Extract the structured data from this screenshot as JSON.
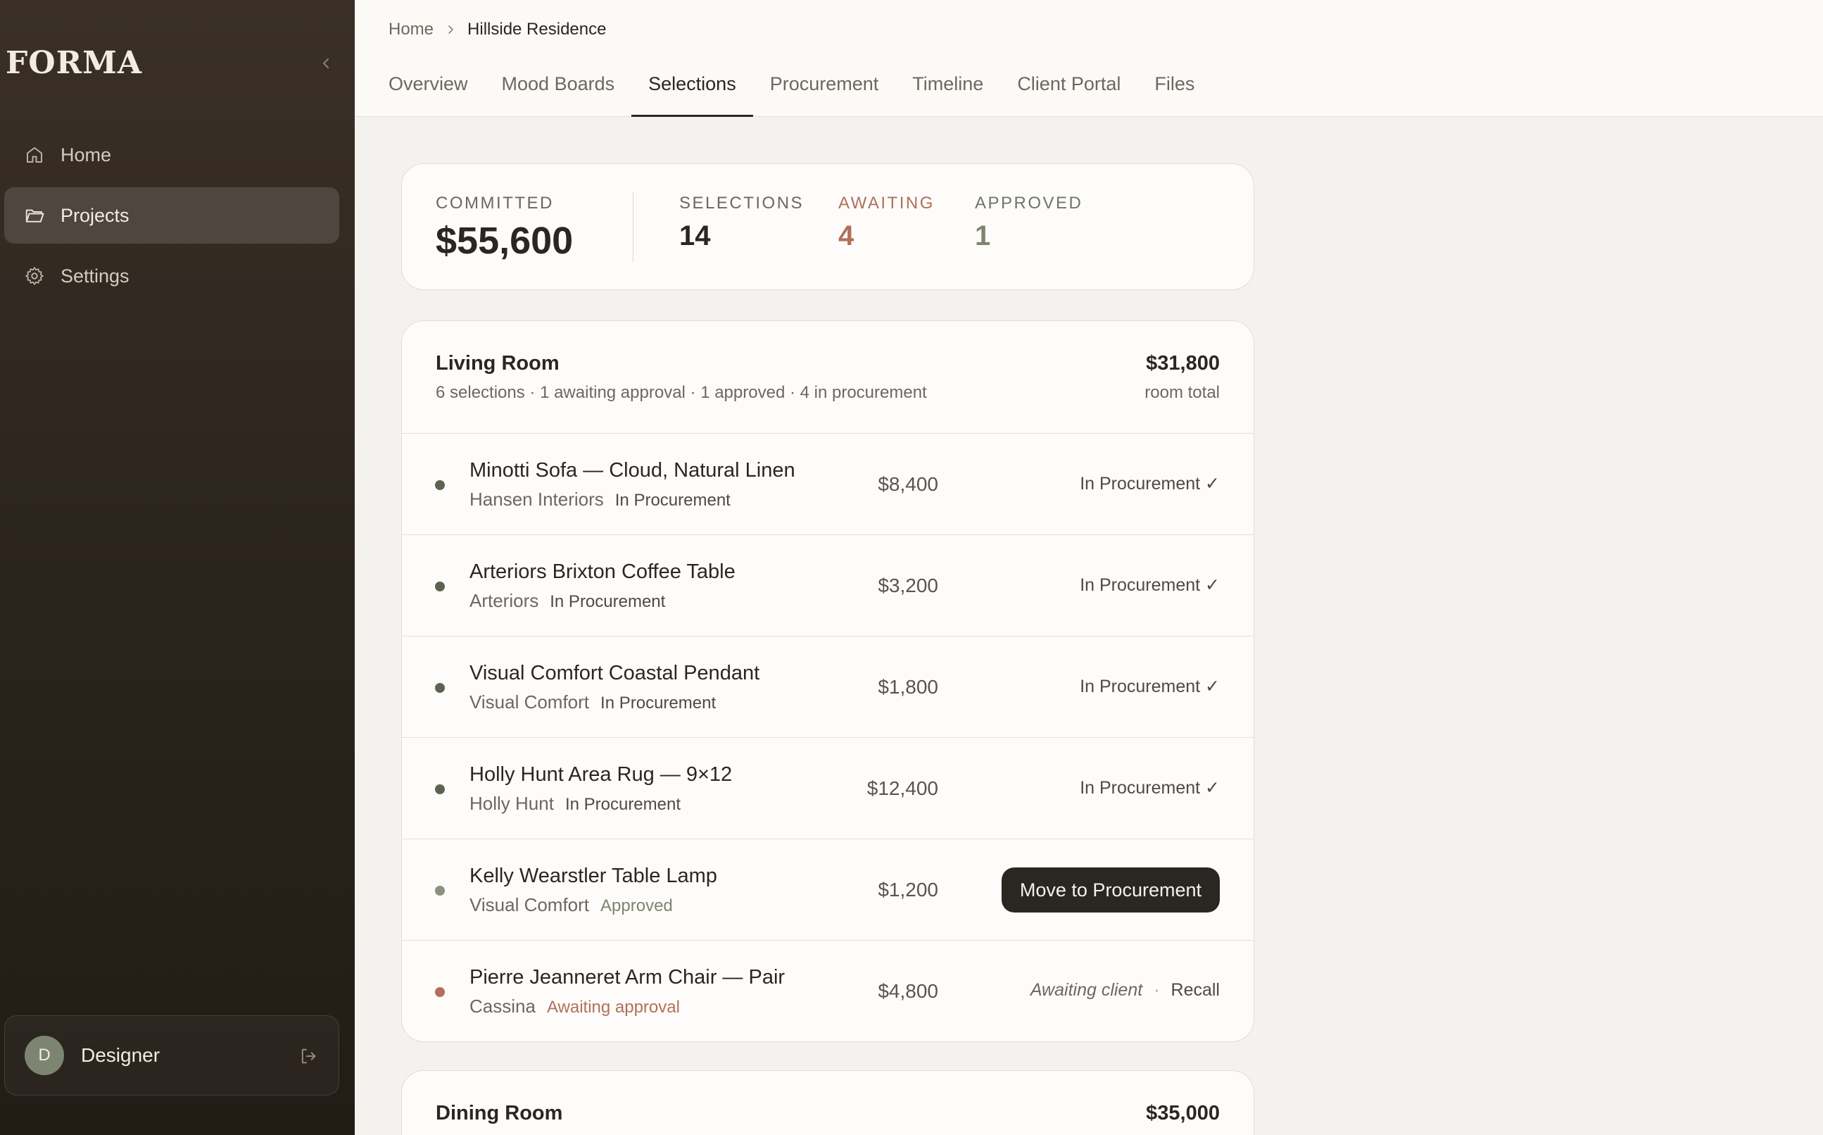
{
  "app": {
    "logo": "FORMA"
  },
  "sidebar": {
    "items": [
      {
        "label": "Home",
        "icon": "home-icon"
      },
      {
        "label": "Projects",
        "icon": "folder-icon",
        "active": true
      },
      {
        "label": "Settings",
        "icon": "gear-icon"
      }
    ],
    "user": {
      "initial": "D",
      "name": "Designer"
    }
  },
  "breadcrumb": {
    "home": "Home",
    "current": "Hillside Residence"
  },
  "tabs": [
    {
      "label": "Overview"
    },
    {
      "label": "Mood Boards"
    },
    {
      "label": "Selections",
      "active": true
    },
    {
      "label": "Procurement"
    },
    {
      "label": "Timeline"
    },
    {
      "label": "Client Portal"
    },
    {
      "label": "Files"
    }
  ],
  "summary": {
    "committed_label": "COMMITTED",
    "committed_value": "$55,600",
    "selections_label": "SELECTIONS",
    "selections_value": "14",
    "awaiting_label": "AWAITING",
    "awaiting_value": "4",
    "approved_label": "APPROVED",
    "approved_value": "1"
  },
  "rooms": [
    {
      "title": "Living Room",
      "meta": "6 selections · 1 awaiting approval · 1 approved · 4 in procurement",
      "total": "$31,800",
      "total_label": "room total",
      "items": [
        {
          "name": "Minotti Sofa — Cloud, Natural Linen",
          "vendor": "Hansen Interiors",
          "status": "In Procurement",
          "price": "$8,400",
          "action": "In Procurement ✓"
        },
        {
          "name": "Arteriors Brixton Coffee Table",
          "vendor": "Arteriors",
          "status": "In Procurement",
          "price": "$3,200",
          "action": "In Procurement ✓"
        },
        {
          "name": "Visual Comfort Coastal Pendant",
          "vendor": "Visual Comfort",
          "status": "In Procurement",
          "price": "$1,800",
          "action": "In Procurement ✓"
        },
        {
          "name": "Holly Hunt Area Rug — 9×12",
          "vendor": "Holly Hunt",
          "status": "In Procurement",
          "price": "$12,400",
          "action": "In Procurement ✓"
        },
        {
          "name": "Kelly Wearstler Table Lamp",
          "vendor": "Visual Comfort",
          "status": "Approved",
          "price": "$1,200",
          "action": "Move to Procurement"
        },
        {
          "name": "Pierre Jeanneret Arm Chair — Pair",
          "vendor": "Cassina",
          "status": "Awaiting approval",
          "price": "$4,800",
          "action": "Awaiting client",
          "action_sep": "·",
          "action2": "Recall"
        }
      ]
    },
    {
      "title": "Dining Room",
      "total": "$35,000"
    }
  ],
  "colors": {
    "sidebar": "#2b241d",
    "accent_awaiting": "#b0705a",
    "accent_approved": "#7d8570",
    "primary_button": "#2a2622"
  }
}
